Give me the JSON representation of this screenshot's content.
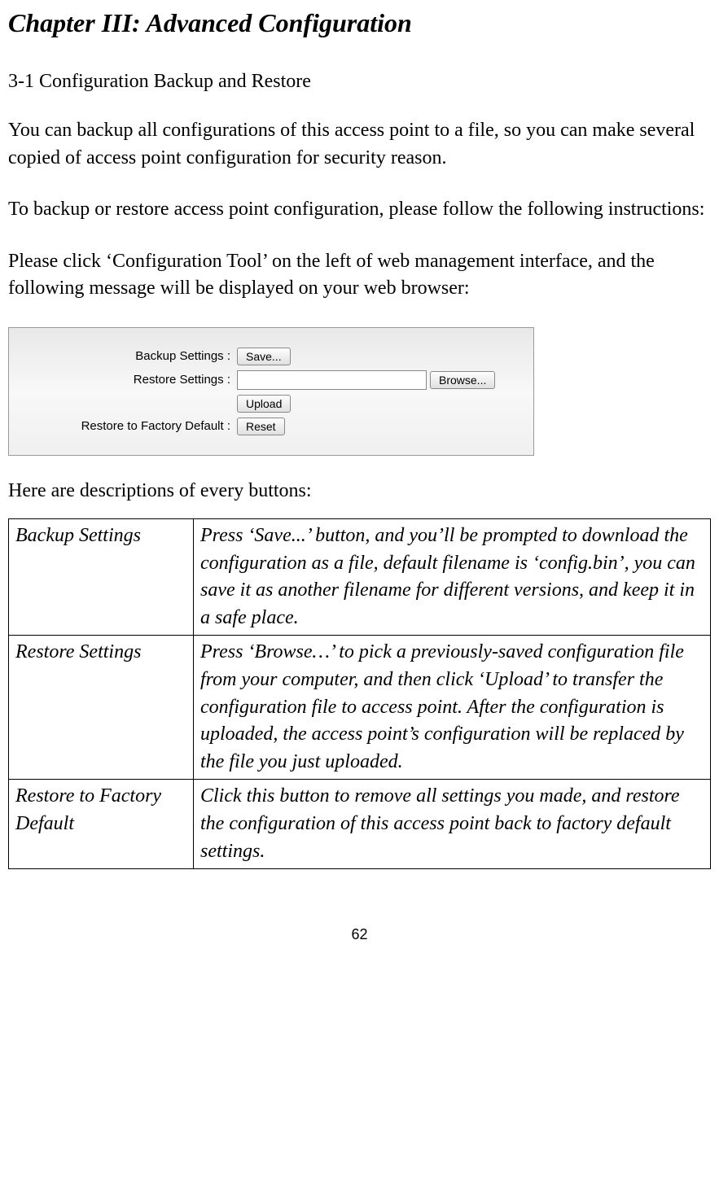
{
  "chapter_title": "Chapter III: Advanced Configuration",
  "section_title": "3-1 Configuration Backup and Restore",
  "paragraphs": {
    "p1": "You can backup all configurations of this access point to a file, so you can make several copied of access point configuration for security reason.",
    "p2": "To backup or restore access point configuration, please follow the following instructions:",
    "p3": "Please click ‘Configuration Tool’ on the left of web management interface, and the following message will be displayed on your web browser:",
    "desc_intro": "Here are descriptions of every buttons:"
  },
  "config_panel": {
    "backup_label": "Backup Settings :",
    "save_button": "Save...",
    "restore_label": "Restore Settings :",
    "file_value": "",
    "browse_button": "Browse...",
    "upload_button": "Upload",
    "factory_label": "Restore to Factory Default :",
    "reset_button": "Reset"
  },
  "table": {
    "rows": [
      {
        "term": "Backup Settings",
        "desc": "Press ‘Save...’ button, and you’ll be prompted to download the configuration as a file, default filename is ‘config.bin’, you can save it as another filename for different versions, and keep it in a safe place."
      },
      {
        "term": "Restore Settings",
        "desc": "Press ‘Browse…’ to pick a previously-saved configuration file from your computer, and then click ‘Upload’ to transfer the configuration file to access point. After the configuration is uploaded, the access point’s configuration will be replaced by the file you just uploaded."
      },
      {
        "term": "Restore to Factory Default",
        "desc": "Click this button to remove all settings you made, and restore the configuration of this access point back to factory default settings."
      }
    ]
  },
  "page_number": "62"
}
